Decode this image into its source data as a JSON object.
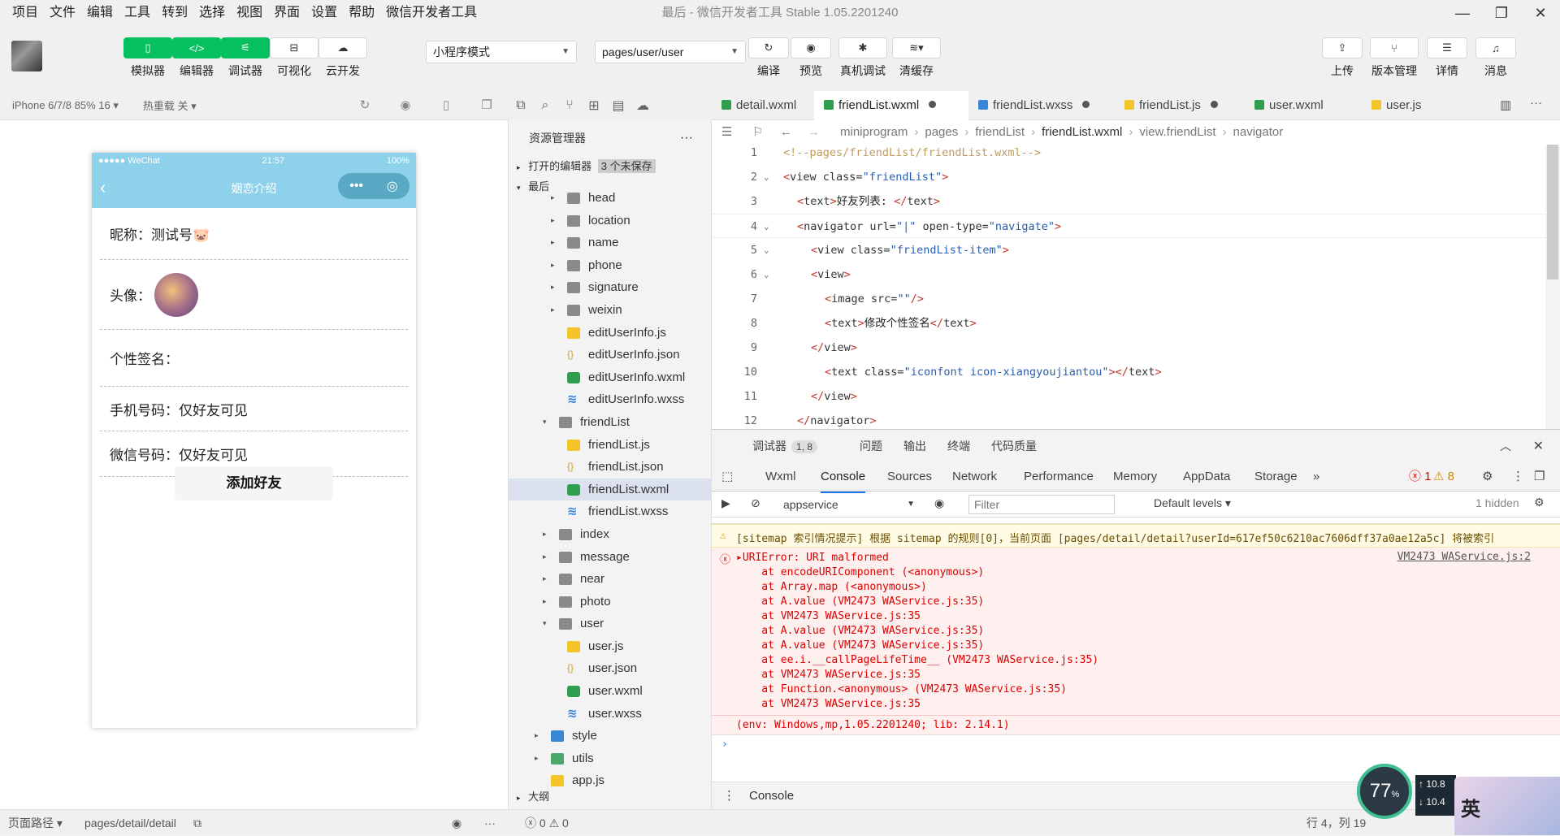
{
  "menubar": {
    "items": [
      "项目",
      "文件",
      "编辑",
      "工具",
      "转到",
      "选择",
      "视图",
      "界面",
      "设置",
      "帮助",
      "微信开发者工具"
    ],
    "window_title": "最后 - 微信开发者工具 Stable 1.05.2201240"
  },
  "toolbar": {
    "left_buttons": [
      {
        "icon": "phone-icon",
        "glyph": "▯",
        "label": "模拟器",
        "active": true
      },
      {
        "icon": "code-icon",
        "glyph": "</>",
        "label": "编辑器",
        "active": true
      },
      {
        "icon": "debug-icon",
        "glyph": "⚟",
        "label": "调试器",
        "active": true
      },
      {
        "icon": "visual-icon",
        "glyph": "⊟",
        "label": "可视化",
        "active": false
      },
      {
        "icon": "cloud-icon",
        "glyph": "☁",
        "label": "云开发",
        "active": false
      }
    ],
    "mode_select": "小程序模式",
    "page_select": "pages/user/user",
    "mid_buttons": [
      {
        "icon": "refresh-icon",
        "glyph": "↻",
        "label": "编译"
      },
      {
        "icon": "eye-icon",
        "glyph": "◉",
        "label": "预览"
      },
      {
        "icon": "bug-icon",
        "glyph": "✱",
        "label": "真机调试"
      },
      {
        "icon": "layers-icon",
        "glyph": "≋▾",
        "label": "清缓存"
      }
    ],
    "right_buttons": [
      {
        "icon": "upload-icon",
        "glyph": "⇪",
        "label": "上传"
      },
      {
        "icon": "branch-icon",
        "glyph": "⑂",
        "label": "版本管理"
      },
      {
        "icon": "menu-icon",
        "glyph": "☰",
        "label": "详情"
      },
      {
        "icon": "bell-icon",
        "glyph": "♫",
        "label": "消息"
      }
    ]
  },
  "simbar": {
    "device": "iPhone 6/7/8 85% 16 ▾",
    "hotreload": "热重载 关 ▾"
  },
  "phone": {
    "carrier": "●●●●● WeChat",
    "time": "21:57",
    "battery": "100%",
    "nav_title": "姻恋介绍",
    "rows": [
      {
        "label": "昵称：测试号🐷"
      },
      {
        "label": "头像："
      },
      {
        "label": "个性签名："
      },
      {
        "label": "手机号码：仅好友可见"
      },
      {
        "label": "微信号码：仅好友可见"
      }
    ],
    "add_button": "添加好友"
  },
  "explorer": {
    "title": "资源管理器",
    "open_editors": "打开的编辑器",
    "unsaved_badge": "3 个未保存",
    "root": "最后",
    "tree": [
      {
        "name": "head",
        "type": "folder",
        "depth": 2,
        "arrow": "▸"
      },
      {
        "name": "location",
        "type": "folder",
        "depth": 2,
        "arrow": "▸"
      },
      {
        "name": "name",
        "type": "folder",
        "depth": 2,
        "arrow": "▸"
      },
      {
        "name": "phone",
        "type": "folder",
        "depth": 2,
        "arrow": "▸"
      },
      {
        "name": "signature",
        "type": "folder",
        "depth": 2,
        "arrow": "▸"
      },
      {
        "name": "weixin",
        "type": "folder",
        "depth": 2,
        "arrow": "▸"
      },
      {
        "name": "editUserInfo.js",
        "type": "js",
        "depth": 2
      },
      {
        "name": "editUserInfo.json",
        "type": "json",
        "depth": 2
      },
      {
        "name": "editUserInfo.wxml",
        "type": "wxml",
        "depth": 2
      },
      {
        "name": "editUserInfo.wxss",
        "type": "wxss",
        "depth": 2
      },
      {
        "name": "friendList",
        "type": "folder",
        "depth": 1,
        "arrow": "▾"
      },
      {
        "name": "friendList.js",
        "type": "js",
        "depth": 2
      },
      {
        "name": "friendList.json",
        "type": "json",
        "depth": 2
      },
      {
        "name": "friendList.wxml",
        "type": "wxml",
        "depth": 2,
        "selected": true
      },
      {
        "name": "friendList.wxss",
        "type": "wxss",
        "depth": 2
      },
      {
        "name": "index",
        "type": "folder",
        "depth": 1,
        "arrow": "▸"
      },
      {
        "name": "message",
        "type": "folder",
        "depth": 1,
        "arrow": "▸"
      },
      {
        "name": "near",
        "type": "folder",
        "depth": 1,
        "arrow": "▸"
      },
      {
        "name": "photo",
        "type": "folder",
        "depth": 1,
        "arrow": "▸"
      },
      {
        "name": "user",
        "type": "folder",
        "depth": 1,
        "arrow": "▾"
      },
      {
        "name": "user.js",
        "type": "js",
        "depth": 2
      },
      {
        "name": "user.json",
        "type": "json",
        "depth": 2
      },
      {
        "name": "user.wxml",
        "type": "wxml",
        "depth": 2
      },
      {
        "name": "user.wxss",
        "type": "wxss",
        "depth": 2
      },
      {
        "name": "style",
        "type": "blue",
        "depth": 0,
        "arrow": "▸"
      },
      {
        "name": "utils",
        "type": "green",
        "depth": 0,
        "arrow": "▸"
      },
      {
        "name": "app.js",
        "type": "js",
        "depth": 0
      }
    ],
    "outline": "大纲"
  },
  "editor_tabs": [
    {
      "name": "detail.wxml",
      "type": "wxml",
      "dirty": false,
      "active": false
    },
    {
      "name": "friendList.wxml",
      "type": "wxml",
      "dirty": true,
      "active": true
    },
    {
      "name": "friendList.wxss",
      "type": "wxss",
      "dirty": true,
      "active": false
    },
    {
      "name": "friendList.js",
      "type": "js",
      "dirty": true,
      "active": false
    },
    {
      "name": "user.wxml",
      "type": "wxml",
      "dirty": false,
      "active": false
    },
    {
      "name": "user.js",
      "type": "js",
      "dirty": false,
      "active": false
    }
  ],
  "breadcrumb": [
    "miniprogram",
    "pages",
    "friendList",
    "friendList.wxml",
    "view.friendList",
    "navigator"
  ],
  "code_lines": [
    {
      "n": "1",
      "fold": "",
      "indent": 0,
      "parts": [
        [
          "com",
          "<!--pages/friendList/friendList.wxml-->"
        ]
      ]
    },
    {
      "n": "2",
      "fold": "⌄",
      "indent": 0,
      "parts": [
        [
          "br",
          "<"
        ],
        [
          "tag",
          "view "
        ],
        [
          "attr",
          "class="
        ],
        [
          "str",
          "\"friendList\""
        ],
        [
          "br",
          ">"
        ]
      ]
    },
    {
      "n": "3",
      "fold": "",
      "indent": 1,
      "parts": [
        [
          "br",
          "<"
        ],
        [
          "tag",
          "text"
        ],
        [
          "br",
          ">"
        ],
        [
          "txt",
          "好友列表: "
        ],
        [
          "br",
          "</"
        ],
        [
          "tag",
          "text"
        ],
        [
          "br",
          ">"
        ]
      ]
    },
    {
      "n": "4",
      "fold": "⌄",
      "indent": 1,
      "parts": [
        [
          "br",
          "<"
        ],
        [
          "tag",
          "navigator "
        ],
        [
          "attr",
          "url="
        ],
        [
          "str",
          "\"|\""
        ],
        [
          "attr",
          " open-type="
        ],
        [
          "str",
          "\"navigate\""
        ],
        [
          "br",
          ">"
        ]
      ]
    },
    {
      "n": "5",
      "fold": "⌄",
      "indent": 2,
      "parts": [
        [
          "br",
          "<"
        ],
        [
          "tag",
          "view "
        ],
        [
          "attr",
          "class="
        ],
        [
          "str",
          "\"friendList-item\""
        ],
        [
          "br",
          ">"
        ]
      ]
    },
    {
      "n": "6",
      "fold": "⌄",
      "indent": 2,
      "parts": [
        [
          "br",
          "<"
        ],
        [
          "tag",
          "view"
        ],
        [
          "br",
          ">"
        ]
      ]
    },
    {
      "n": "7",
      "fold": "",
      "indent": 3,
      "parts": [
        [
          "br",
          "<"
        ],
        [
          "tag",
          "image "
        ],
        [
          "attr",
          "src="
        ],
        [
          "str",
          "\"\""
        ],
        [
          "br",
          "/>"
        ]
      ]
    },
    {
      "n": "8",
      "fold": "",
      "indent": 3,
      "parts": [
        [
          "br",
          "<"
        ],
        [
          "tag",
          "text"
        ],
        [
          "br",
          ">"
        ],
        [
          "txt",
          "修改个性签名"
        ],
        [
          "br",
          "</"
        ],
        [
          "tag",
          "text"
        ],
        [
          "br",
          ">"
        ]
      ]
    },
    {
      "n": "9",
      "fold": "",
      "indent": 2,
      "parts": [
        [
          "br",
          "</"
        ],
        [
          "tag",
          "view"
        ],
        [
          "br",
          ">"
        ]
      ]
    },
    {
      "n": "10",
      "fold": "",
      "indent": 3,
      "parts": [
        [
          "br",
          "<"
        ],
        [
          "tag",
          "text "
        ],
        [
          "attr",
          "class="
        ],
        [
          "str",
          "\"iconfont icon-xiangyoujiantou\""
        ],
        [
          "br",
          "></"
        ],
        [
          "tag",
          "text"
        ],
        [
          "br",
          ">"
        ]
      ]
    },
    {
      "n": "11",
      "fold": "",
      "indent": 2,
      "parts": [
        [
          "br",
          "</"
        ],
        [
          "tag",
          "view"
        ],
        [
          "br",
          ">"
        ]
      ]
    },
    {
      "n": "12",
      "fold": "",
      "indent": 1,
      "parts": [
        [
          "br",
          "</"
        ],
        [
          "tag",
          "navigator"
        ],
        [
          "br",
          ">"
        ]
      ]
    }
  ],
  "devtools": {
    "title": "调试器",
    "count": "1, 8",
    "panels": [
      "问题",
      "输出",
      "终端",
      "代码质量"
    ],
    "tabs": [
      "Wxml",
      "Console",
      "Sources",
      "Network",
      "Performance",
      "Memory",
      "AppData",
      "Storage"
    ],
    "active_tab": "Console",
    "err_count": "1",
    "warn_count": "8",
    "context": "appservice",
    "filter_placeholder": "Filter",
    "levels": "Default levels ▾",
    "hidden": "1 hidden",
    "warn_msg": "[sitemap 索引情况提示] 根据 sitemap 的规则[0]，当前页面 [pages/detail/detail?userId=617ef50c6210ac7606dff37a0ae12a5c] 将被索引",
    "err_title": "▸URIError: URI malformed",
    "err_link": "VM2473 WAService.js:2",
    "stack": [
      "    at encodeURIComponent (<anonymous>)",
      "    at Array.map (<anonymous>)",
      "    at A.value (VM2473 WAService.js:35)",
      "    at VM2473 WAService.js:35",
      "    at A.value (VM2473 WAService.js:35)",
      "    at A.value (VM2473 WAService.js:35)",
      "    at ee.i.__callPageLifeTime__ (VM2473 WAService.js:35)",
      "    at VM2473 WAService.js:35",
      "    at Function.<anonymous> (VM2473 WAService.js:35)",
      "    at VM2473 WAService.js:35"
    ],
    "env": "(env: Windows,mp,1.05.2201240; lib: 2.14.1)",
    "prompt": "›",
    "bottom_tab": "Console"
  },
  "statusbar": {
    "path_label": "页面路径 ▾",
    "path": "pages/detail/detail",
    "errs": "ⓧ 0 ⚠ 0",
    "cursor": "行 4，列 19"
  },
  "overlay": {
    "percent": "77",
    "percent_unit": "%",
    "up": "↑ 10.8",
    "down": "↓ 10.4",
    "ime": "英"
  },
  "colors": {
    "accent": "#07c160",
    "nav": "#8ed1ea",
    "error": "#d00000",
    "warn_bg": "#fffbe5"
  }
}
